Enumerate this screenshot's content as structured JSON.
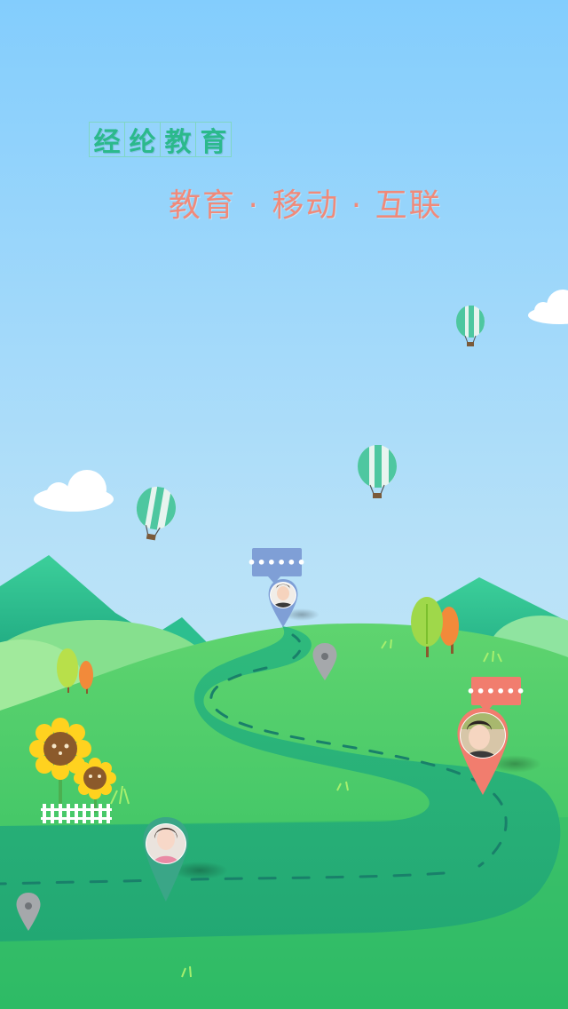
{
  "brand": {
    "chars": [
      "经",
      "纶",
      "教",
      "育"
    ]
  },
  "tagline": "教育 · 移动 · 互联",
  "map": {
    "bubble_1": "••••••",
    "bubble_2": "••••••"
  },
  "colors": {
    "sky_top": "#83cdfd",
    "sky_bottom": "#cdebf4",
    "brand_green": "#2bb98c",
    "tagline_coral": "#f08a7a",
    "road": "#2db37a",
    "pin_blue": "#7f9fd6",
    "pin_coral": "#f17d6e",
    "pin_teal": "#3aa687",
    "pin_gray": "#9aa0a3"
  }
}
